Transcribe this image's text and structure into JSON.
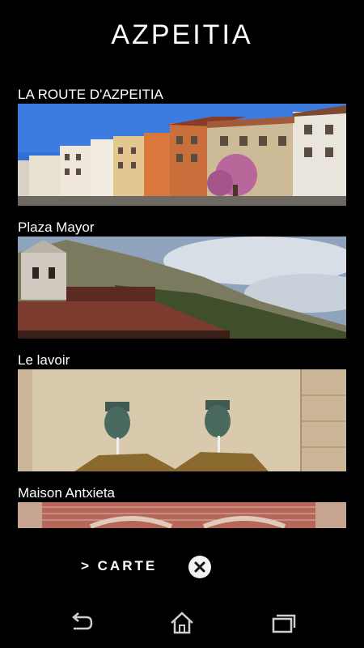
{
  "app": {
    "title": "AZPEITIA"
  },
  "places": [
    {
      "label": "LA ROUTE D'AZPEITIA",
      "image": "street-buildings-photo"
    },
    {
      "label": "Plaza Mayor",
      "image": "church-and-hills-photo"
    },
    {
      "label": "Le lavoir",
      "image": "stone-fountain-photo"
    },
    {
      "label": "Maison Antxieta",
      "image": "brick-facade-photo"
    }
  ],
  "footer": {
    "map_label": "> CARTE",
    "close_icon": "close-circle-icon"
  },
  "system_nav": {
    "back_icon": "back-icon",
    "home_icon": "home-icon",
    "recents_icon": "recent-apps-icon"
  }
}
